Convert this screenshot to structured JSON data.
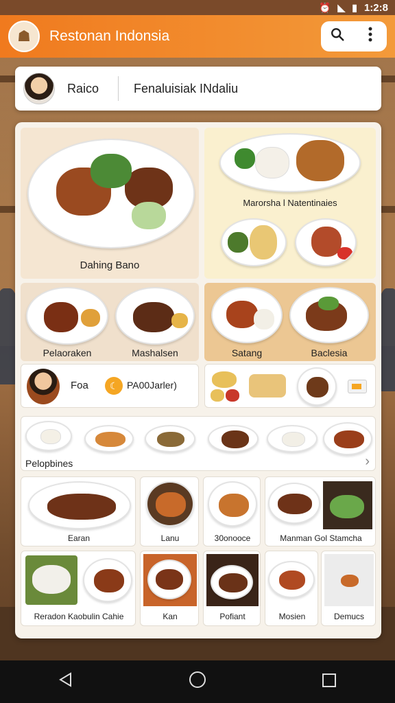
{
  "status_bar": {
    "time": "1:2:8"
  },
  "app": {
    "title": "Restonan Indonsia"
  },
  "profile": {
    "name": "Raico",
    "subtitle": "Fenaluisiak INdaliu"
  },
  "featured": {
    "left_caption": "Dahing Bano",
    "right_caption": "Marorsha l Natentinaies"
  },
  "row2": {
    "items": [
      "Pelaoraken",
      "Mashalsen",
      "Satang",
      "Baclesia"
    ]
  },
  "promo": {
    "label": "Foa",
    "tag": "PA00Jarler)"
  },
  "strip": {
    "label": "Pelopbines",
    "arrow": "›"
  },
  "grid_row1": [
    "Earan",
    "Lanu",
    "30onooce",
    "Manman Gol Stamcha"
  ],
  "grid_row2": [
    "Reradon Kaobulin Cahie",
    "Kan",
    "Pofiant",
    "Mosien",
    "Demucs"
  ],
  "icons": {
    "search": "search-icon",
    "menu": "more-vert-icon",
    "back": "back-icon",
    "home": "home-icon",
    "recents": "recents-icon"
  },
  "colors": {
    "appbar": "#f07a1e",
    "accent": "#f5a623",
    "panel": "#f7f2ea"
  }
}
